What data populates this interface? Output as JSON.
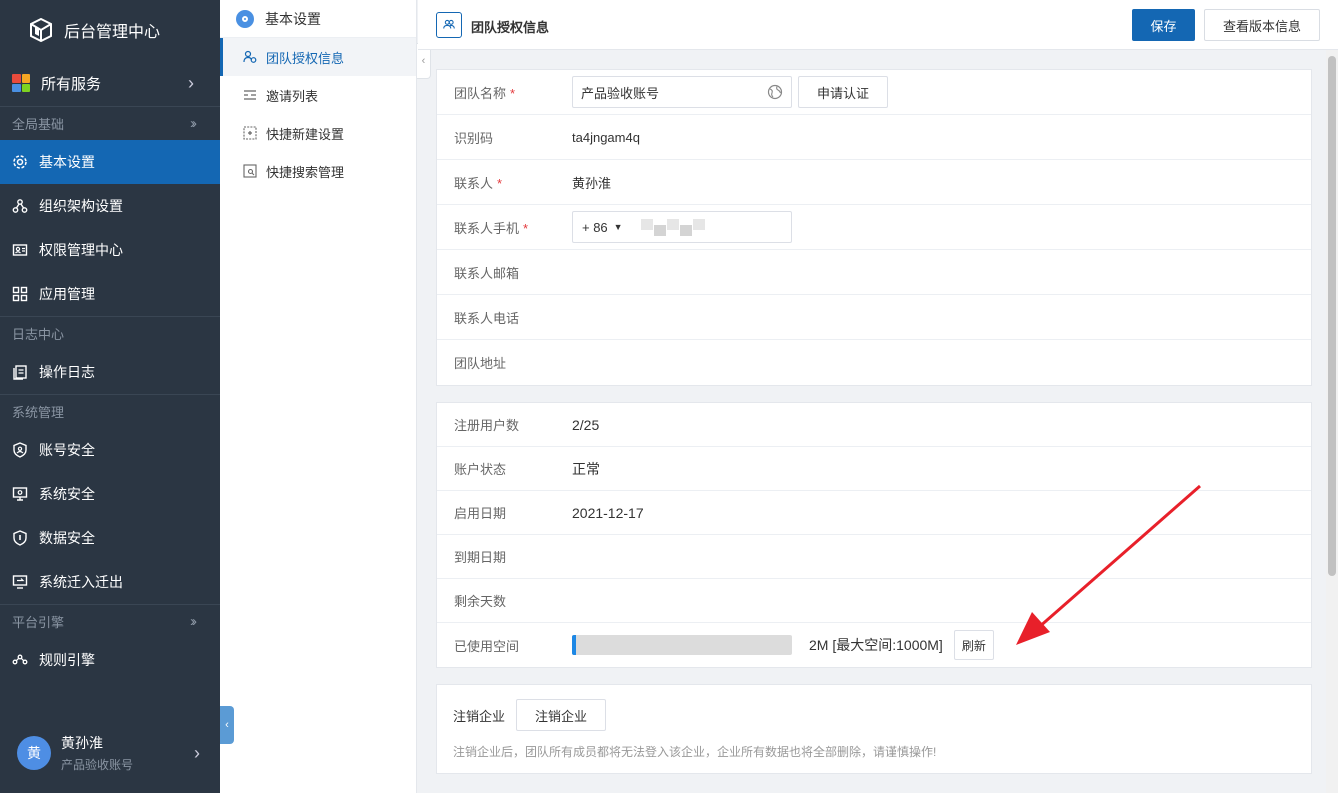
{
  "sidebar": {
    "brand": "后台管理中心",
    "all_services": "所有服务",
    "groups": [
      {
        "header": "全局基础",
        "items": [
          "基本设置",
          "组织架构设置",
          "权限管理中心",
          "应用管理"
        ]
      },
      {
        "header": "日志中心",
        "items": [
          "操作日志"
        ]
      },
      {
        "header": "系统管理",
        "items": [
          "账号安全",
          "系统安全",
          "数据安全",
          "系统迁入迁出"
        ]
      },
      {
        "header": "平台引擎",
        "items": [
          "规则引擎"
        ]
      }
    ],
    "user": {
      "avatar": "黄",
      "name": "黄孙淮",
      "account": "产品验收账号"
    }
  },
  "submenu": {
    "title": "基本设置",
    "items": [
      "团队授权信息",
      "邀请列表",
      "快捷新建设置",
      "快捷搜索管理"
    ]
  },
  "header": {
    "title": "团队授权信息",
    "save": "保存",
    "view_version": "查看版本信息"
  },
  "team": {
    "name_label": "团队名称",
    "name_value": "产品验收账号",
    "certify_button": "申请认证",
    "code_label": "识别码",
    "code_value": "ta4jngam4q",
    "contact_label": "联系人",
    "contact_value": "黄孙淮",
    "phone_label": "联系人手机",
    "phone_cc": "+ 86",
    "email_label": "联系人邮箱",
    "tel_label": "联系人电话",
    "address_label": "团队地址",
    "required_mark": "*"
  },
  "account": {
    "users_label": "注册用户数",
    "users_value": "2/25",
    "status_label": "账户状态",
    "status_value": "正常",
    "start_label": "启用日期",
    "start_value": "2021-12-17",
    "end_label": "到期日期",
    "remaining_label": "剩余天数",
    "space_label": "已使用空间",
    "space_used_fraction": 0.02,
    "space_text": "2M [最大空间:1000M]",
    "refresh": "刷新"
  },
  "cancel": {
    "label": "注销企业",
    "button": "注销企业",
    "note": "注销企业后，团队所有成员都将无法登入该企业，企业所有数据也将全部删除，请谨慎操作!"
  },
  "colors": {
    "sidebar_bg": "#2b3643",
    "accent": "#1467b3",
    "required": "#e4393c",
    "arrow": "#e8202a"
  }
}
